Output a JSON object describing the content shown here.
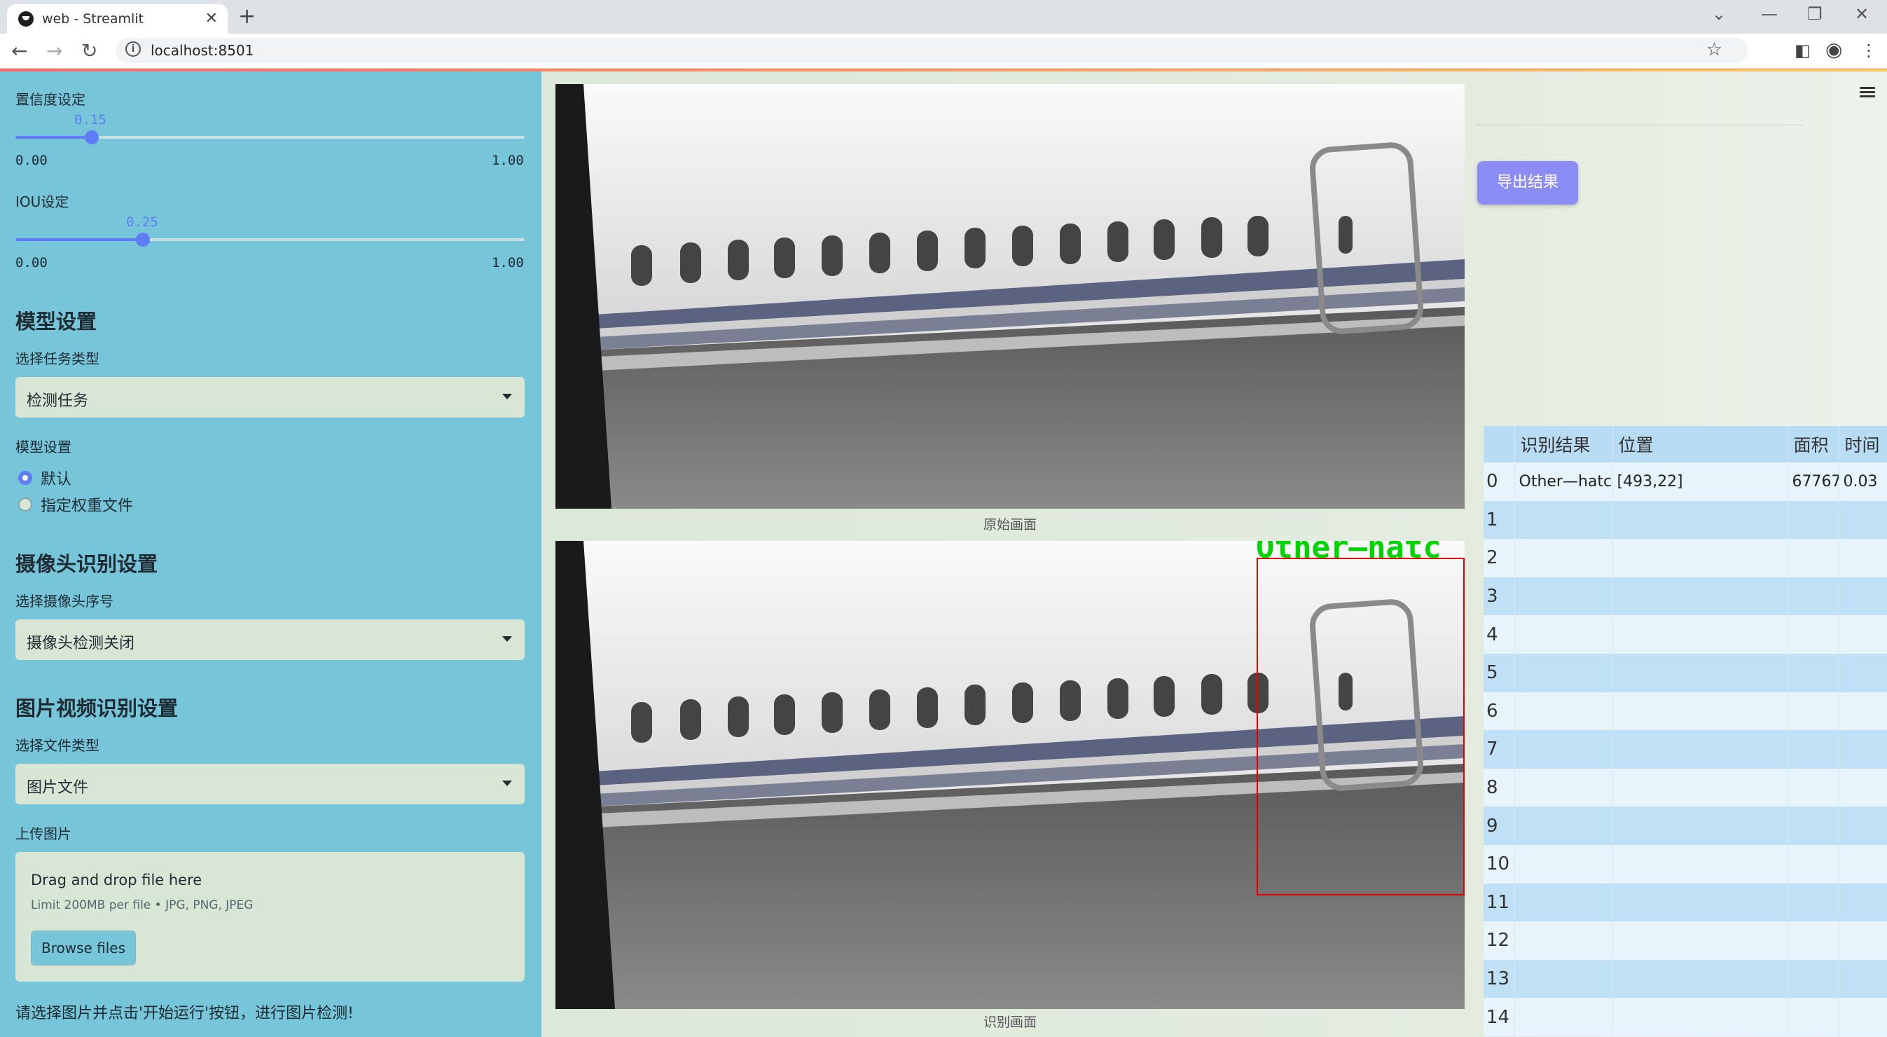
{
  "browser": {
    "tab_title": "web - Streamlit",
    "url": "localhost:8501"
  },
  "sidebar": {
    "confidence": {
      "label": "置信度设定",
      "value": "0.15",
      "value_num": 0.15,
      "min": "0.00",
      "max": "1.00"
    },
    "iou": {
      "label": "IOU设定",
      "value": "0.25",
      "value_num": 0.25,
      "min": "0.00",
      "max": "1.00"
    },
    "model_section": {
      "heading": "模型设置",
      "task_label": "选择任务类型",
      "task_value": "检测任务",
      "model_label": "模型设置",
      "options": [
        "默认",
        "指定权重文件"
      ],
      "selected": "默认"
    },
    "camera_section": {
      "heading": "摄像头识别设置",
      "camera_label": "选择摄像头序号",
      "camera_value": "摄像头检测关闭"
    },
    "file_section": {
      "heading": "图片视频识别设置",
      "filetype_label": "选择文件类型",
      "filetype_value": "图片文件",
      "upload_label": "上传图片",
      "drop_title": "Drag and drop file here",
      "drop_limit": "Limit 200MB per file • JPG, PNG, JPEG",
      "browse_label": "Browse files"
    },
    "note": "请选择图片并点击'开始运行'按钮，进行图片检测!"
  },
  "main": {
    "original_caption": "原始画面",
    "detected_caption": "识别画面",
    "detection_label": "Other—hatc",
    "export_label": "导出结果"
  },
  "results": {
    "columns": [
      "识别结果",
      "位置",
      "面积",
      "时间"
    ],
    "rows": [
      {
        "index": "0",
        "label": "Other—hatches",
        "position": "[493,22]",
        "area": "67767",
        "time": "0.03"
      },
      {
        "index": "1"
      },
      {
        "index": "2"
      },
      {
        "index": "3"
      },
      {
        "index": "4"
      },
      {
        "index": "5"
      },
      {
        "index": "6"
      },
      {
        "index": "7"
      },
      {
        "index": "8"
      },
      {
        "index": "9"
      },
      {
        "index": "10"
      },
      {
        "index": "11"
      },
      {
        "index": "12"
      },
      {
        "index": "13"
      },
      {
        "index": "14"
      }
    ]
  },
  "colors": {
    "sidebar_bg": "#77c5d9",
    "accent": "#5f7ef6",
    "export_button": "#8c8cf5",
    "box": "#e00000",
    "box_label": "#00d400"
  }
}
